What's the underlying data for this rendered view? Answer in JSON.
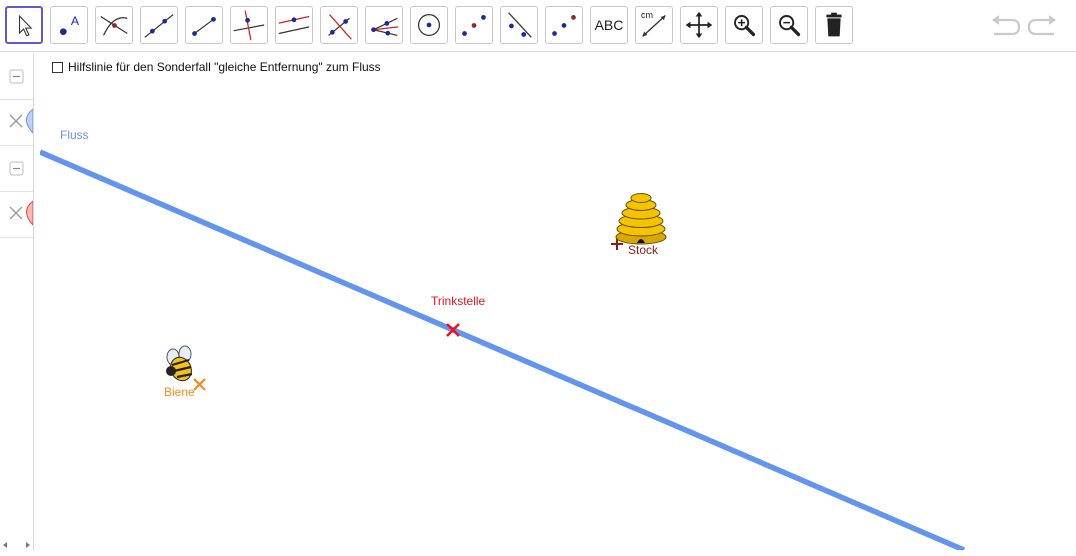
{
  "toolbar": {
    "tools": [
      {
        "name": "move-tool",
        "active": true
      },
      {
        "name": "point-tool"
      },
      {
        "name": "intersect-tool"
      },
      {
        "name": "line-tool"
      },
      {
        "name": "segment-tool"
      },
      {
        "name": "perpendicular-line-tool"
      },
      {
        "name": "parallel-line-tool"
      },
      {
        "name": "perpendicular-bisector-tool"
      },
      {
        "name": "angle-bisector-tool"
      },
      {
        "name": "circle-tool"
      },
      {
        "name": "midpoint-tool"
      },
      {
        "name": "reflect-about-line-tool"
      },
      {
        "name": "reflect-about-point-tool"
      },
      {
        "name": "text-tool",
        "label": "ABC"
      },
      {
        "name": "distance-tool",
        "label": "cm"
      },
      {
        "name": "move-graphics-view-tool"
      },
      {
        "name": "zoom-in-tool"
      },
      {
        "name": "zoom-out-tool"
      },
      {
        "name": "delete-tool"
      }
    ],
    "undo": "undo-icon",
    "redo": "redo-icon"
  },
  "graphics": {
    "checkbox_label": "Hilfslinie für den Sonderfall \"gleiche Entfernung\" zum Fluss",
    "checkbox_checked": false,
    "river_label": "Fluss",
    "hive_label": "Stock",
    "drinking_point_label": "Trinkstelle",
    "bee_label": "Biene"
  },
  "colors": {
    "river": "#6495ed",
    "drinking_point": "#e8141f",
    "bee_point": "#f28c1c",
    "hive_point": "#8b1a1a",
    "active_tool": "#6557d2"
  }
}
